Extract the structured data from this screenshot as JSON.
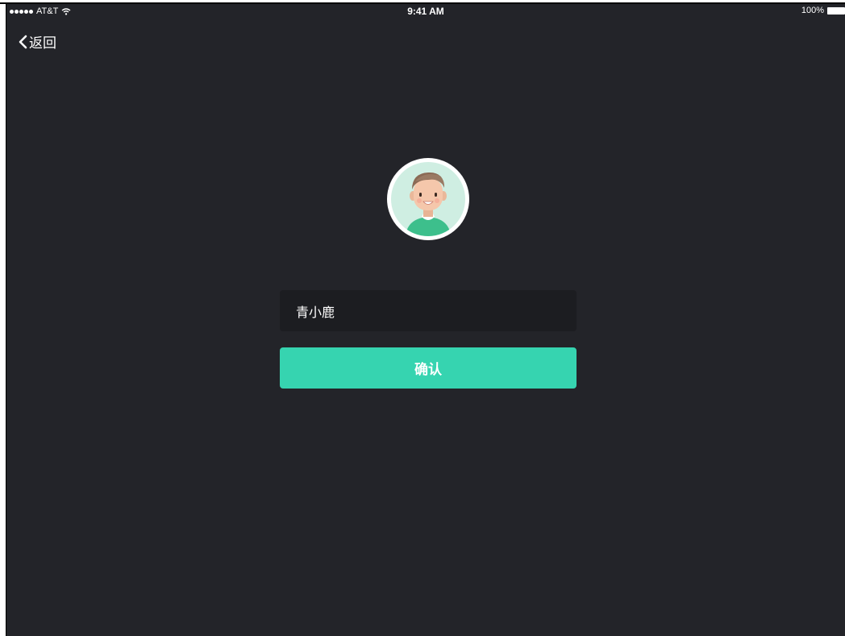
{
  "status_bar": {
    "carrier": "AT&T",
    "time": "9:41 AM",
    "battery": "100%",
    "icons": [
      "signal-dots-icon",
      "wifi-icon",
      "battery-icon"
    ]
  },
  "nav": {
    "back_label": "返回",
    "back_icon": "chevron-left-icon"
  },
  "avatar": {
    "icon": "user-avatar-icon"
  },
  "form": {
    "name_value": "青小鹿",
    "confirm_label": "确认"
  },
  "colors": {
    "background": "#232429",
    "input_background": "#1c1d21",
    "accent": "#36d4b0",
    "text": "#ffffff"
  }
}
